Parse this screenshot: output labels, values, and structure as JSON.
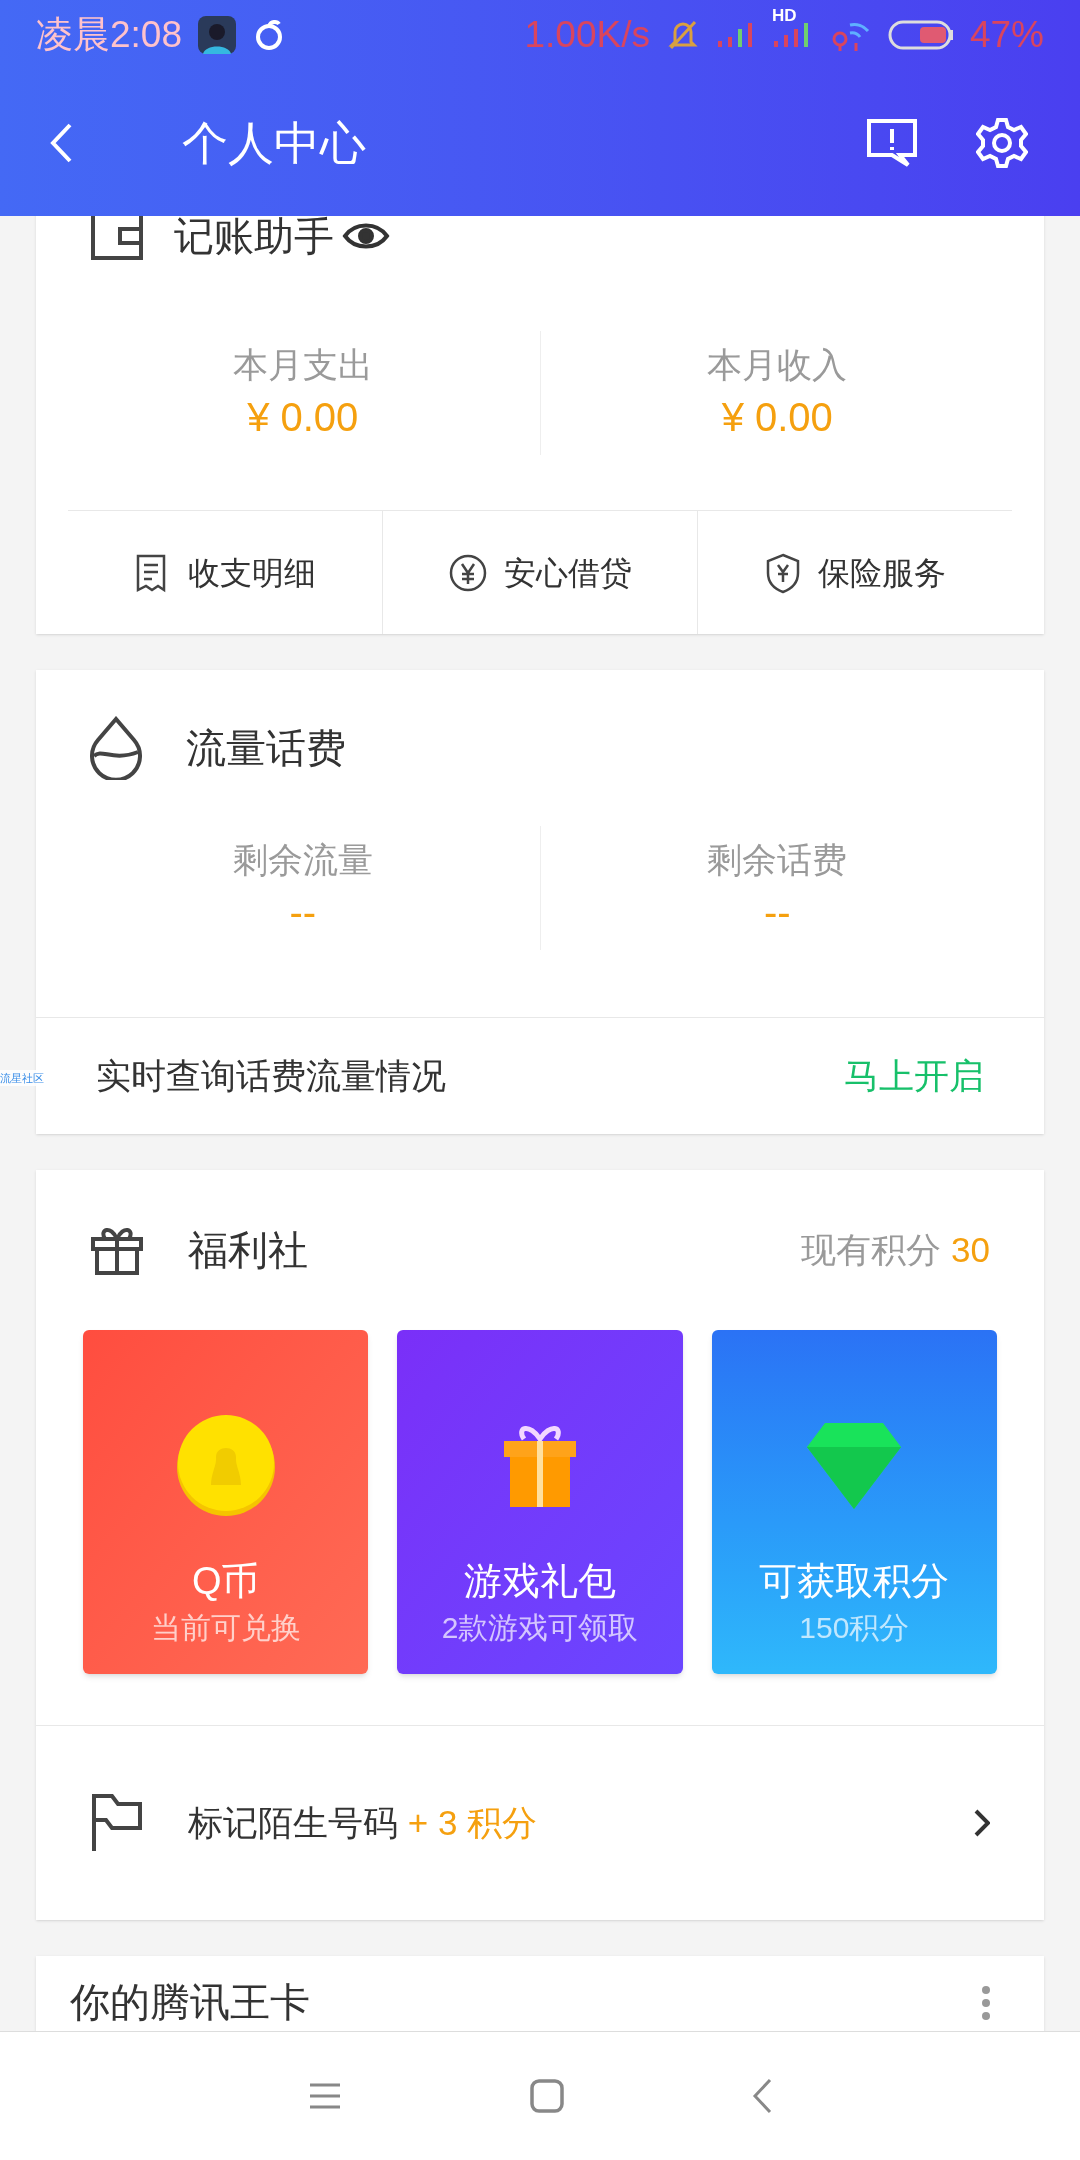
{
  "status_bar": {
    "time": "凌晨2:08",
    "speed": "1.00K/s",
    "network_badge": "HD",
    "battery": "47%"
  },
  "header": {
    "title": "个人中心"
  },
  "wallet_card": {
    "title": "记账助手",
    "stats": [
      {
        "label": "本月支出",
        "value": "¥ 0.00"
      },
      {
        "label": "本月收入",
        "value": "¥ 0.00"
      }
    ],
    "links": [
      {
        "kind": "receipt",
        "label": "收支明细"
      },
      {
        "kind": "yen",
        "label": "安心借贷"
      },
      {
        "kind": "shield",
        "label": "保险服务"
      }
    ]
  },
  "data_card": {
    "title": "流量话费",
    "stats": [
      {
        "label": "剩余流量",
        "value": "--"
      },
      {
        "label": "剩余话费",
        "value": "--"
      }
    ],
    "prompt": "实时查询话费流量情况",
    "action": "马上开启"
  },
  "float_label": "流星社区",
  "welfare_card": {
    "title": "福利社",
    "points_label": "现有积分",
    "points": "30",
    "tiles": [
      {
        "kind": "coin",
        "title": "Q币",
        "subtitle": "当前可兑换"
      },
      {
        "kind": "gift",
        "title": "游戏礼包",
        "subtitle": "2款游戏可领取"
      },
      {
        "kind": "gem",
        "title": "可获取积分",
        "subtitle": "150积分"
      }
    ],
    "task": {
      "text": "标记陌生号码",
      "bonus": "+ 3 积分"
    }
  },
  "tencent_card": {
    "title": "你的腾讯王卡"
  }
}
